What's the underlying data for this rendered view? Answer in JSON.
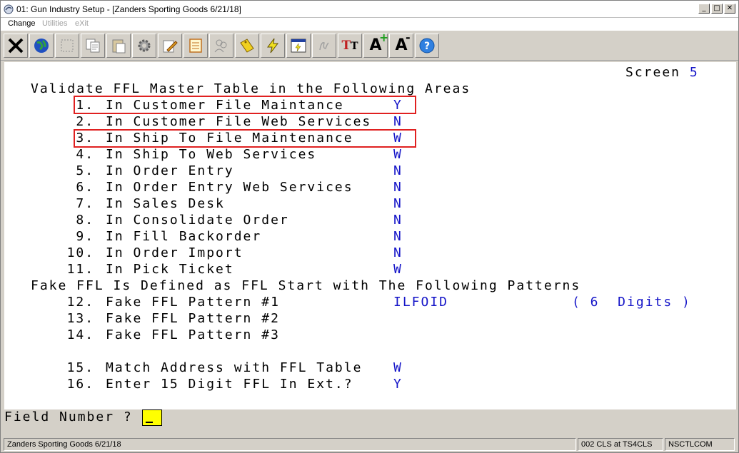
{
  "window": {
    "title": "01: Gun Industry Setup - [Zanders Sporting Goods 6/21/18]",
    "minimize": "_",
    "maximize": "□",
    "close": "✕"
  },
  "menu": {
    "change": "Change",
    "utilities": "Utilities",
    "exit": "eXit"
  },
  "toolbar": [
    {
      "name": "close-tool",
      "icon": "x-icon"
    },
    {
      "name": "globe-tool",
      "icon": "globe-icon"
    },
    {
      "name": "select-tool",
      "icon": "blank-icon"
    },
    {
      "name": "copy-tool",
      "icon": "copy-icon"
    },
    {
      "name": "paste-tool",
      "icon": "paste-icon"
    },
    {
      "name": "settings-tool",
      "icon": "gear-icon"
    },
    {
      "name": "edit-tool",
      "icon": "pencil-icon"
    },
    {
      "name": "notes-tool",
      "icon": "notepad-icon"
    },
    {
      "name": "users-tool",
      "icon": "users-icon"
    },
    {
      "name": "tag-tool",
      "icon": "tag-icon"
    },
    {
      "name": "lightning-tool",
      "icon": "lightning-icon"
    },
    {
      "name": "run-tool",
      "icon": "run-window-icon"
    },
    {
      "name": "script-tool",
      "icon": "script-icon"
    },
    {
      "name": "font-tool",
      "icon": "font-icon",
      "text": "TT"
    },
    {
      "name": "font-increase-tool",
      "icon": "font-increase-icon",
      "text": "A"
    },
    {
      "name": "font-decrease-tool",
      "icon": "font-decrease-icon",
      "text": "A"
    },
    {
      "name": "help-tool",
      "icon": "help-icon"
    }
  ],
  "screen": {
    "label": "Screen",
    "number": "5",
    "section1_title": "Validate FFL Master Table in the Following Areas",
    "section2_title": "Fake FFL Is Defined as FFL Start with The Following Patterns",
    "fields": [
      {
        "num": "1.",
        "label": "In Customer File Maintance",
        "value": "Y"
      },
      {
        "num": "2.",
        "label": "In Customer File Web Services",
        "value": "N"
      },
      {
        "num": "3.",
        "label": "In Ship To File Maintenance",
        "value": "W"
      },
      {
        "num": "4.",
        "label": "In Ship To Web Services",
        "value": "W"
      },
      {
        "num": "5.",
        "label": "In Order Entry",
        "value": "N"
      },
      {
        "num": "6.",
        "label": "In Order Entry Web Services",
        "value": "N"
      },
      {
        "num": "7.",
        "label": "In Sales Desk",
        "value": "N"
      },
      {
        "num": "8.",
        "label": "In Consolidate Order",
        "value": "N"
      },
      {
        "num": "9.",
        "label": "In Fill Backorder",
        "value": "N"
      },
      {
        "num": "10.",
        "label": "In Order Import",
        "value": "N"
      },
      {
        "num": "11.",
        "label": "In Pick Ticket",
        "value": "W"
      },
      {
        "num": "12.",
        "label": "Fake FFL Pattern #1",
        "value": "ILFOID",
        "extra": "( 6  Digits )"
      },
      {
        "num": "13.",
        "label": "Fake FFL Pattern #2",
        "value": ""
      },
      {
        "num": "14.",
        "label": "Fake FFL Pattern #3",
        "value": ""
      },
      {
        "num": "15.",
        "label": "Match Address with FFL Table",
        "value": "W"
      },
      {
        "num": "16.",
        "label": "Enter 15 Digit FFL In Ext.?",
        "value": "Y"
      }
    ],
    "prompt": "Field Number ?"
  },
  "status": {
    "company": "Zanders Sporting Goods 6/21/18",
    "session": "002 CLS at TS4CLS",
    "program": "NSCTLCOM"
  },
  "colors": {
    "value_text": "#1515c8",
    "highlight": "#e02020",
    "prompt_input": "#ffff00"
  }
}
